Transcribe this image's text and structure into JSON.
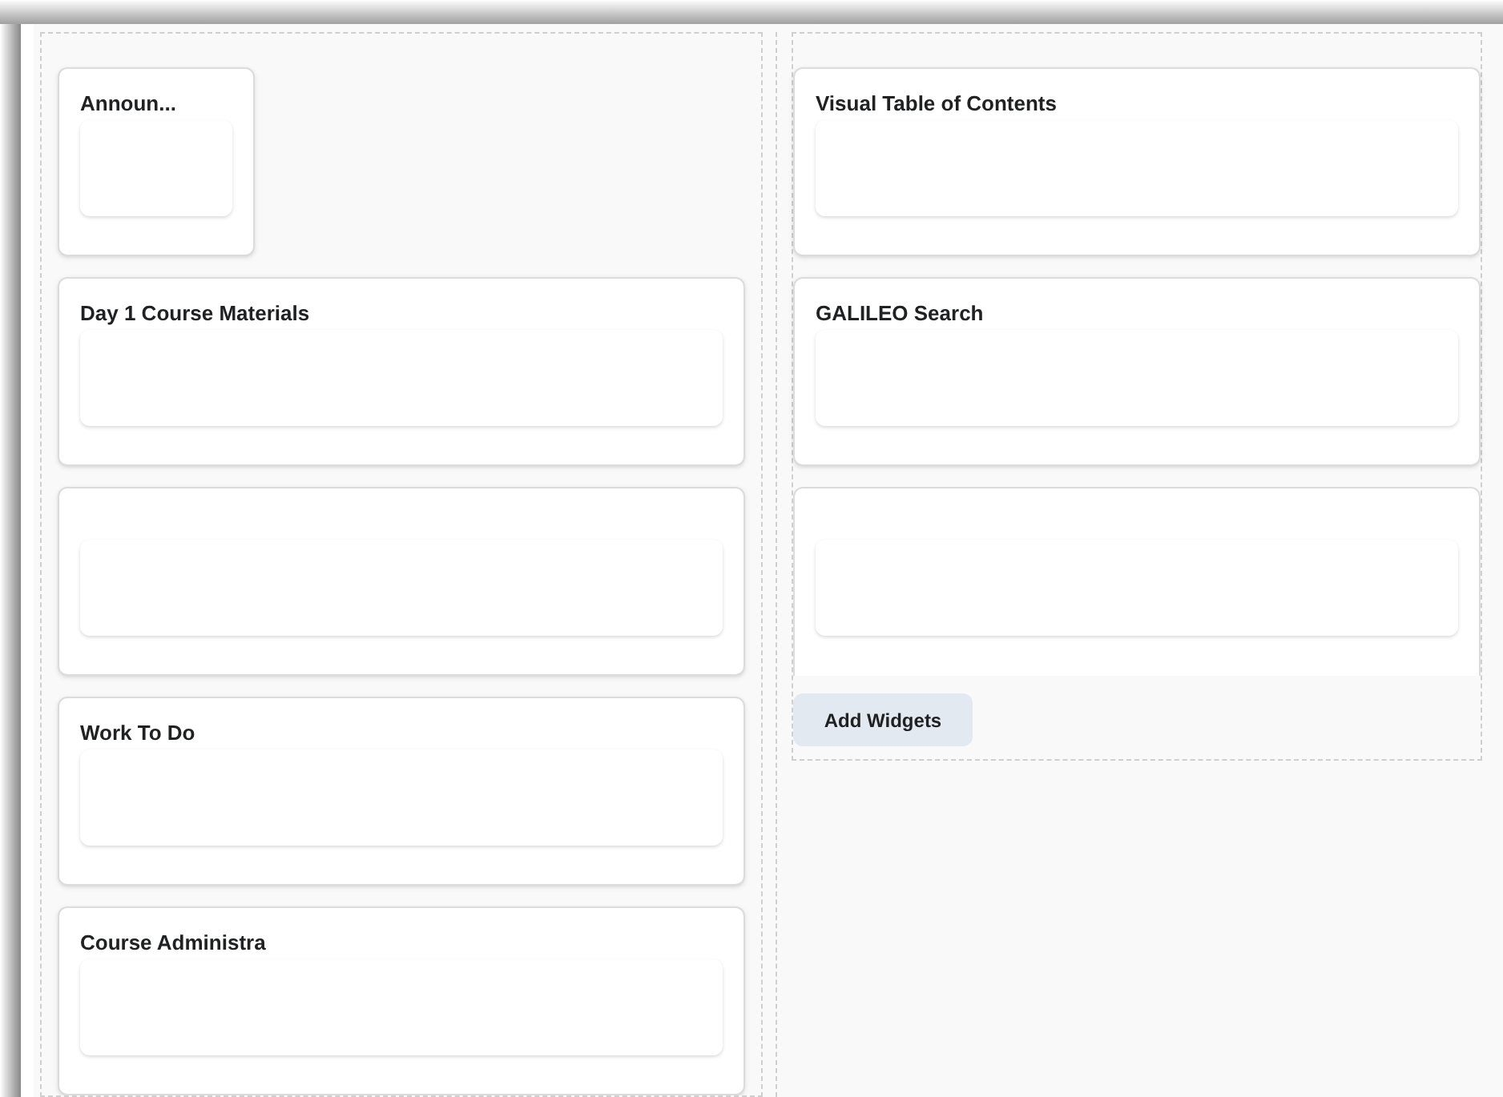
{
  "columns": [
    {
      "widgets": [
        {
          "title": "Announ...",
          "kind": "narrow"
        },
        {
          "title": "Day 1 Course Materials",
          "kind": "full"
        },
        {
          "kind": "full"
        },
        {
          "title": "Work To Do",
          "kind": "full"
        },
        {
          "title": "Course Administra",
          "kind": "full"
        }
      ]
    },
    {
      "widgets": [
        {
          "title": "Visual Table of Contents",
          "kind": "full"
        },
        {
          "title": "GALILEO Search",
          "kind": "full"
        },
        {
          "kind": "open"
        }
      ],
      "add_button": "Add Widgets"
    }
  ]
}
